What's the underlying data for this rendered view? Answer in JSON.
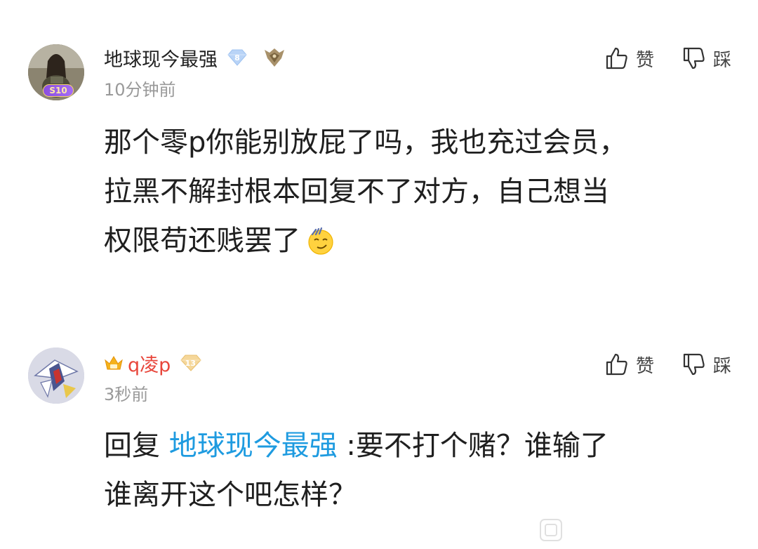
{
  "comments": [
    {
      "username": "地球现今最强",
      "level": "8",
      "avatar_frame_badge": "S10",
      "time": "10分钟前",
      "like_label": "赞",
      "dislike_label": "踩",
      "lines": [
        "那个零p你能别放屁了吗，我也充过会员，",
        "拉黑不解封根本回复不了对方，自己想当",
        "权限苟还贱罢了"
      ],
      "emoji": "smug-emoji"
    },
    {
      "username": "q凌p",
      "level": "13",
      "time": "3秒前",
      "like_label": "赞",
      "dislike_label": "踩",
      "reply_prefix": "回复 ",
      "mention": "地球现今最强",
      "line1_rest": " :要不打个赌？谁输了",
      "line2": "谁离开这个吧怎样？"
    }
  ],
  "colors": {
    "mention": "#1e9be0",
    "vip_name": "#e8463b",
    "time": "#999999"
  },
  "icons": {
    "like": "thumbs-up-icon",
    "dislike": "thumbs-down-icon",
    "crown": "crown-icon",
    "rank": "rank-emblem-icon",
    "level": "diamond-level-icon"
  }
}
